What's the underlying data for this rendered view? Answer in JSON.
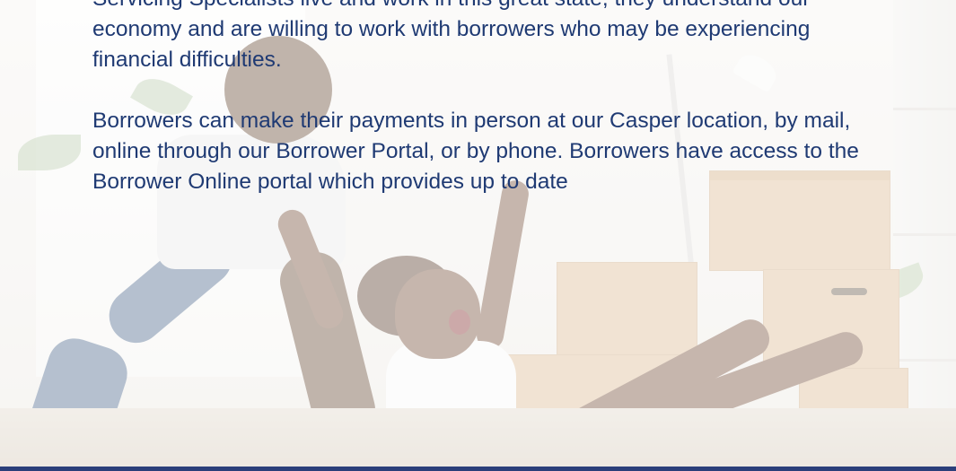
{
  "content": {
    "paragraph_1": "Servicing Specialists live and work in this great state, they understand our economy and are willing to work with borrowers who may be experiencing financial difficulties.",
    "paragraph_2": "Borrowers can make their payments in person at our Casper location, by mail, online through our Borrower Portal, or by phone. Borrowers have access to the Borrower Online portal which provides up to date"
  },
  "colors": {
    "text": "#1f3a73",
    "bottom_bar": "#2b3f7a",
    "overlay": "rgba(255,255,255,0.62)"
  }
}
